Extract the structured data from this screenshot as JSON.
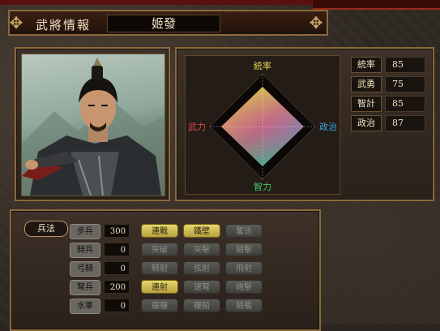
{
  "title": {
    "label": "武將情報",
    "name": "姬發"
  },
  "stats": [
    {
      "label": "統率",
      "value": "85"
    },
    {
      "label": "武勇",
      "value": "75"
    },
    {
      "label": "智計",
      "value": "85"
    },
    {
      "label": "政治",
      "value": "87"
    }
  ],
  "diamond": {
    "top": "統率",
    "left": "武力",
    "right": "政治",
    "bottom": "智力"
  },
  "troops": {
    "section_label": "兵法",
    "rows": [
      {
        "label": "步兵",
        "value": "300",
        "skills": [
          {
            "name": "連戰",
            "on": true
          },
          {
            "name": "鐵壁",
            "on": true
          },
          {
            "name": "奮迅",
            "on": false
          }
        ]
      },
      {
        "label": "騎兵",
        "value": "0",
        "skills": [
          {
            "name": "突破",
            "on": false
          },
          {
            "name": "突擊",
            "on": false
          },
          {
            "name": "鬪擊",
            "on": false
          }
        ]
      },
      {
        "label": "弓騎",
        "value": "0",
        "skills": [
          {
            "name": "騎射",
            "on": false
          },
          {
            "name": "弦射",
            "on": false
          },
          {
            "name": "飛射",
            "on": false
          }
        ]
      },
      {
        "label": "弩兵",
        "value": "200",
        "skills": [
          {
            "name": "連射",
            "on": true
          },
          {
            "name": "速弩",
            "on": false
          },
          {
            "name": "砲擊",
            "on": false
          }
        ]
      },
      {
        "label": "水軍",
        "value": "0",
        "skills": [
          {
            "name": "艨艟",
            "on": false
          },
          {
            "name": "樓船",
            "on": false
          },
          {
            "name": "鬪艦",
            "on": false
          }
        ]
      }
    ]
  },
  "colors": {
    "accent": "#c8a466",
    "skill_on": "#e8d86c",
    "skill_off": "#4a4a46"
  }
}
